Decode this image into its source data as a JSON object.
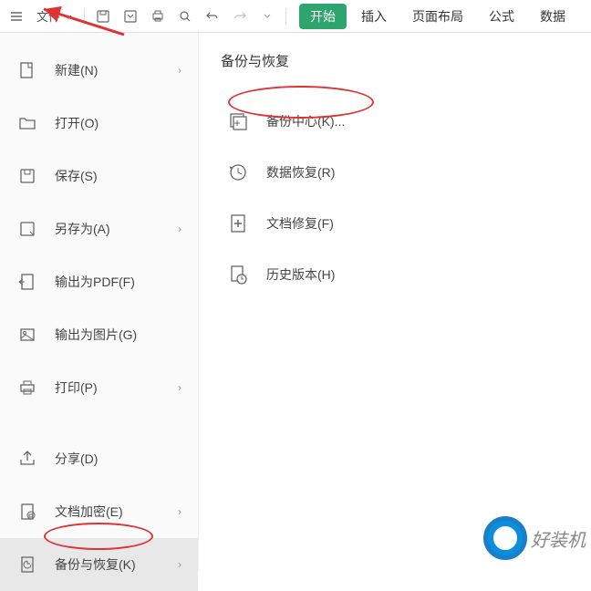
{
  "toolbar": {
    "file_label": "文件",
    "tabs": {
      "start": "开始",
      "insert": "插入",
      "page_layout": "页面布局",
      "formula": "公式",
      "data": "数据"
    }
  },
  "sidebar": {
    "items": [
      {
        "label": "新建(N)",
        "icon": "new-doc",
        "chevron": true
      },
      {
        "label": "打开(O)",
        "icon": "open-folder",
        "chevron": false
      },
      {
        "label": "保存(S)",
        "icon": "save",
        "chevron": false
      },
      {
        "label": "另存为(A)",
        "icon": "save-as",
        "chevron": true
      },
      {
        "label": "输出为PDF(F)",
        "icon": "export-pdf",
        "chevron": false
      },
      {
        "label": "输出为图片(G)",
        "icon": "export-image",
        "chevron": false
      },
      {
        "label": "打印(P)",
        "icon": "print",
        "chevron": true
      },
      {
        "label": "分享(D)",
        "icon": "share",
        "chevron": false
      },
      {
        "label": "文档加密(E)",
        "icon": "encrypt",
        "chevron": true
      },
      {
        "label": "备份与恢复(K)",
        "icon": "backup",
        "chevron": true
      }
    ]
  },
  "panel": {
    "title": "备份与恢复",
    "items": [
      {
        "label": "备份中心(K)...",
        "icon": "backup-center"
      },
      {
        "label": "数据恢复(R)",
        "icon": "data-recover"
      },
      {
        "label": "文档修复(F)",
        "icon": "doc-repair"
      },
      {
        "label": "历史版本(H)",
        "icon": "history"
      }
    ]
  },
  "watermark": {
    "text": "好装机"
  }
}
